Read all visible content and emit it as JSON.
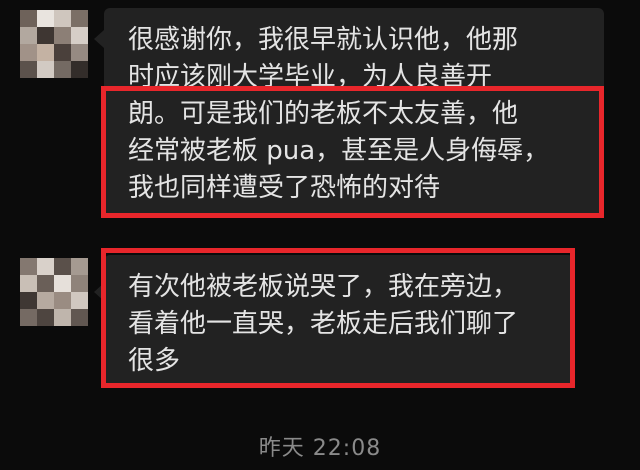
{
  "messages": [
    {
      "lines": [
        "很感谢你，我很早就认识他，他那",
        "时应该刚大学毕业，为人良善开",
        "朗。可是我们的老板不太友善，他",
        "经常被老板 pua，甚至是人身侮辱，",
        "我也同样遭受了恐怖的对待"
      ]
    },
    {
      "lines": [
        "有次他被老板说哭了，我在旁边，",
        "看着他一直哭，老板走后我们聊了",
        "很多"
      ]
    }
  ],
  "timestamp": "昨天 22:08",
  "colors": {
    "background": "#0b0b0b",
    "bubble": "#222222",
    "text": "#e4e4e4",
    "highlight": "#e8262b",
    "timestamp": "#8a8a8a"
  },
  "icons": {
    "avatar": "pixelated-avatar"
  }
}
